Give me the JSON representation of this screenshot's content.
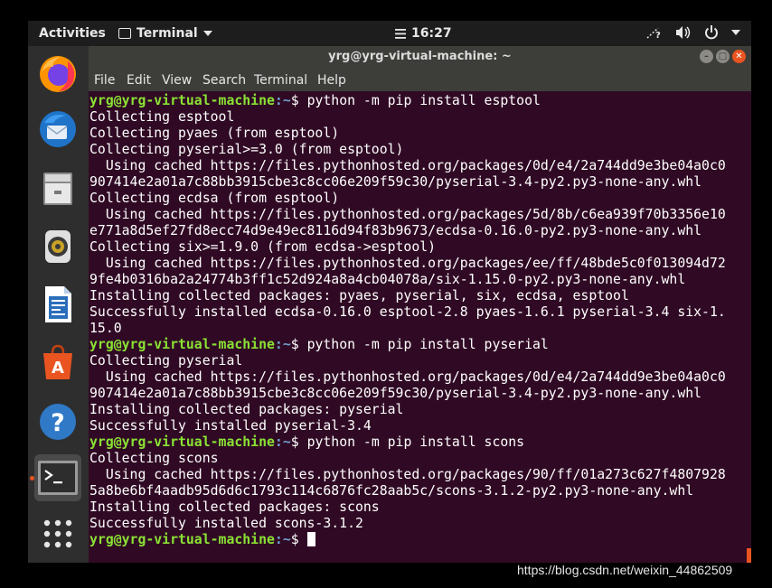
{
  "topbar": {
    "activities": "Activities",
    "app_name": "Terminal",
    "clock": "16:27",
    "tray_icons": [
      "network-icon",
      "volume-icon",
      "power-icon",
      "chevron-down-icon"
    ]
  },
  "dock": {
    "items": [
      "firefox-icon",
      "thunderbird-icon",
      "files-icon",
      "rhythmbox-icon",
      "libreoffice-writer-icon",
      "software-center-icon",
      "help-icon",
      "terminal-icon",
      "show-apps-icon"
    ],
    "active": "terminal-icon",
    "accent": "#e95420"
  },
  "window": {
    "title": "yrg@yrg-virtual-machine: ~",
    "menu": [
      "File",
      "Edit",
      "View",
      "Search",
      "Terminal",
      "Help"
    ]
  },
  "terminal": {
    "prompt_user": "yrg@yrg-virtual-machine",
    "prompt_path": ":~",
    "prompt_end": "$",
    "lines": [
      {
        "type": "prompt",
        "cmd": " python -m pip install esptool"
      },
      {
        "type": "out",
        "text": "Collecting esptool"
      },
      {
        "type": "out",
        "text": "Collecting pyaes (from esptool)"
      },
      {
        "type": "out",
        "text": "Collecting pyserial>=3.0 (from esptool)"
      },
      {
        "type": "out",
        "text": "  Using cached https://files.pythonhosted.org/packages/0d/e4/2a744dd9e3be04a0c0"
      },
      {
        "type": "out",
        "text": "907414e2a01a7c88bb3915cbe3c8cc06e209f59c30/pyserial-3.4-py2.py3-none-any.whl"
      },
      {
        "type": "out",
        "text": "Collecting ecdsa (from esptool)"
      },
      {
        "type": "out",
        "text": "  Using cached https://files.pythonhosted.org/packages/5d/8b/c6ea939f70b3356e10"
      },
      {
        "type": "out",
        "text": "e771a8d5ef27fd8ecc74d9e49ec8116d94f83b9673/ecdsa-0.16.0-py2.py3-none-any.whl"
      },
      {
        "type": "out",
        "text": "Collecting six>=1.9.0 (from ecdsa->esptool)"
      },
      {
        "type": "out",
        "text": "  Using cached https://files.pythonhosted.org/packages/ee/ff/48bde5c0f013094d72"
      },
      {
        "type": "out",
        "text": "9fe4b0316ba2a24774b3ff1c52d924a8a4cb04078a/six-1.15.0-py2.py3-none-any.whl"
      },
      {
        "type": "out",
        "text": "Installing collected packages: pyaes, pyserial, six, ecdsa, esptool"
      },
      {
        "type": "out",
        "text": "Successfully installed ecdsa-0.16.0 esptool-2.8 pyaes-1.6.1 pyserial-3.4 six-1."
      },
      {
        "type": "out",
        "text": "15.0"
      },
      {
        "type": "prompt",
        "cmd": " python -m pip install pyserial"
      },
      {
        "type": "out",
        "text": "Collecting pyserial"
      },
      {
        "type": "out",
        "text": "  Using cached https://files.pythonhosted.org/packages/0d/e4/2a744dd9e3be04a0c0"
      },
      {
        "type": "out",
        "text": "907414e2a01a7c88bb3915cbe3c8cc06e209f59c30/pyserial-3.4-py2.py3-none-any.whl"
      },
      {
        "type": "out",
        "text": "Installing collected packages: pyserial"
      },
      {
        "type": "out",
        "text": "Successfully installed pyserial-3.4"
      },
      {
        "type": "prompt",
        "cmd": " python -m pip install scons"
      },
      {
        "type": "out",
        "text": "Collecting scons"
      },
      {
        "type": "out",
        "text": "  Using cached https://files.pythonhosted.org/packages/90/ff/01a273c627f4807928"
      },
      {
        "type": "out",
        "text": "5a8be6bf4aadb95d6d6c1793c114c6876fc28aab5c/scons-3.1.2-py2.py3-none-any.whl"
      },
      {
        "type": "out",
        "text": "Installing collected packages: scons"
      },
      {
        "type": "out",
        "text": "Successfully installed scons-3.1.2"
      },
      {
        "type": "prompt",
        "cmd": " "
      }
    ],
    "colors": {
      "background": "#300a24",
      "text": "#ffffff",
      "user": "#8ae234",
      "path": "#729fcf"
    }
  },
  "watermark": "https://blog.csdn.net/weixin_44862509"
}
